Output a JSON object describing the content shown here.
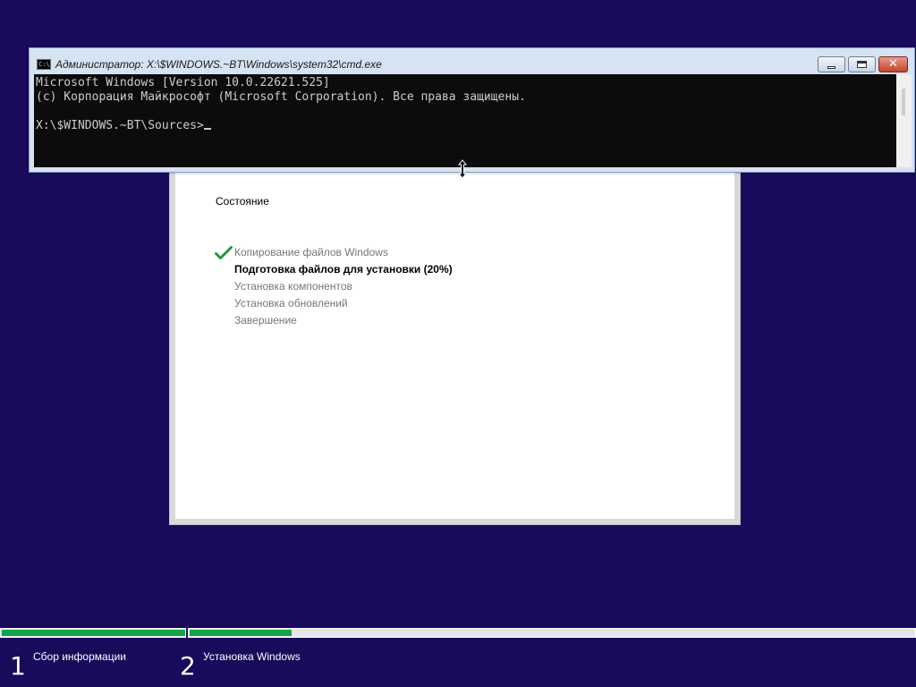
{
  "setup": {
    "status_title": "Состояние",
    "steps": [
      {
        "label": "Копирование файлов Windows",
        "state": "done"
      },
      {
        "label": "Подготовка файлов для установки (20%)",
        "state": "active"
      },
      {
        "label": "Установка компонентов",
        "state": "pending"
      },
      {
        "label": "Установка обновлений",
        "state": "pending"
      },
      {
        "label": "Завершение",
        "state": "pending"
      }
    ]
  },
  "cmd": {
    "title": "Администратор: X:\\$WINDOWS.~BT\\Windows\\system32\\cmd.exe",
    "icon_text": "C:\\",
    "lines": [
      "Microsoft Windows [Version 10.0.22621.525]",
      "(c) Корпорация Майкрософт (Microsoft Corporation). Все права защищены.",
      "",
      "X:\\$WINDOWS.~BT\\Sources>"
    ],
    "close_glyph": "✕"
  },
  "progress": {
    "phases": [
      {
        "number": "1",
        "label": "Сбор информации",
        "fraction": 1.0
      },
      {
        "number": "2",
        "label": "Установка Windows",
        "fraction": 0.14
      }
    ]
  },
  "colors": {
    "background": "#1a0a5c",
    "progress_fill": "#14a24a",
    "check": "#1e9a3c"
  },
  "icons": {
    "check": "check-icon",
    "resize": "resize-vertical-icon",
    "cmd_app": "cmd-app-icon"
  }
}
